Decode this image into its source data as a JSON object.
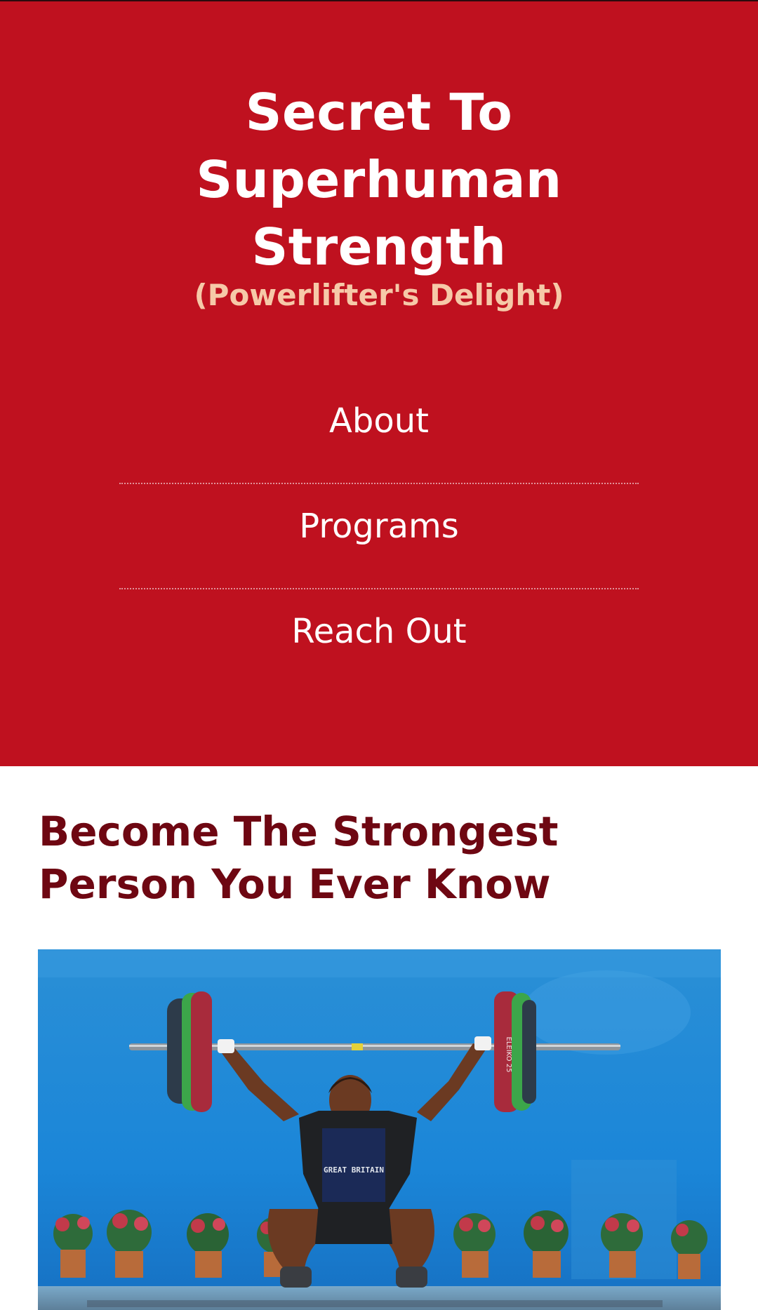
{
  "header": {
    "title_lines": [
      "Secret To",
      "Superhuman",
      "Strength"
    ],
    "tagline": "(Powerlifter's Delight)",
    "background_color": "#bf111f",
    "tagline_color": "#f6c9a8"
  },
  "nav": {
    "items": [
      {
        "label": "About"
      },
      {
        "label": "Programs"
      },
      {
        "label": "Reach Out"
      }
    ]
  },
  "main": {
    "heading_lines": [
      "Become The Strongest",
      "Person You Ever Know"
    ],
    "heading_color": "#6e0712",
    "hero_image": {
      "shirt_text": "GREAT BRITAIN",
      "plate_text": "ELEIKO 25"
    }
  }
}
